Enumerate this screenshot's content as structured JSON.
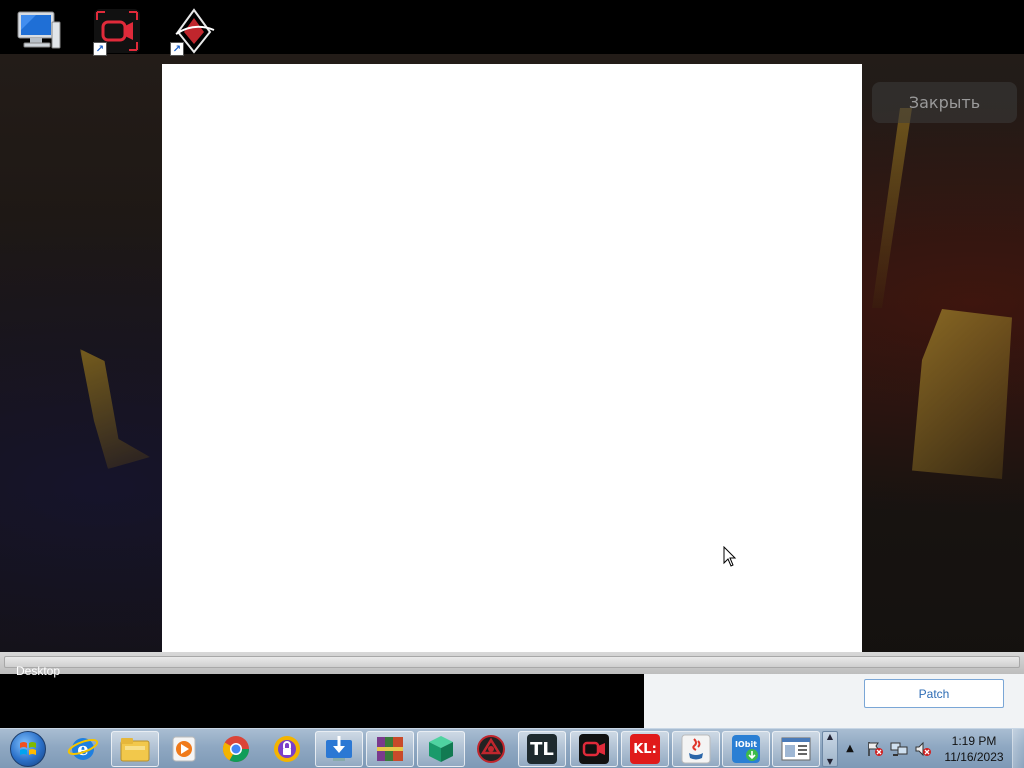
{
  "overlay": {
    "close_label": "Закрыть",
    "patch_label": "Patch",
    "desktop_label": "Desktop"
  },
  "desktop_icons": [
    {
      "name": "computer-icon"
    },
    {
      "name": "video-recorder-shortcut-icon"
    },
    {
      "name": "rocket-game-shortcut-icon"
    }
  ],
  "taskbar": {
    "start": "start-orb-icon",
    "items": [
      {
        "name": "internet-explorer-icon"
      },
      {
        "name": "file-explorer-icon"
      },
      {
        "name": "media-player-icon"
      },
      {
        "name": "chrome-icon"
      },
      {
        "name": "vpn-lock-icon"
      },
      {
        "name": "download-manager-icon"
      },
      {
        "name": "winrar-icon"
      },
      {
        "name": "green-cube-icon"
      },
      {
        "name": "game-booster-icon"
      },
      {
        "name": "tl-launcher-icon",
        "text": "TL"
      },
      {
        "name": "screen-recorder-icon"
      },
      {
        "name": "kl-icon",
        "text": "KL:"
      },
      {
        "name": "java-icon"
      },
      {
        "name": "iobit-icon",
        "text": "IObit"
      },
      {
        "name": "window-app-icon"
      }
    ],
    "clock": {
      "time": "1:19 PM",
      "date": "11/16/2023"
    }
  },
  "colors": {
    "taskbar_top": "#a9bdd2",
    "modal_bg": "#ffffff",
    "patch_text": "#2d6cb5",
    "close_bg": "#3c3c3c"
  }
}
